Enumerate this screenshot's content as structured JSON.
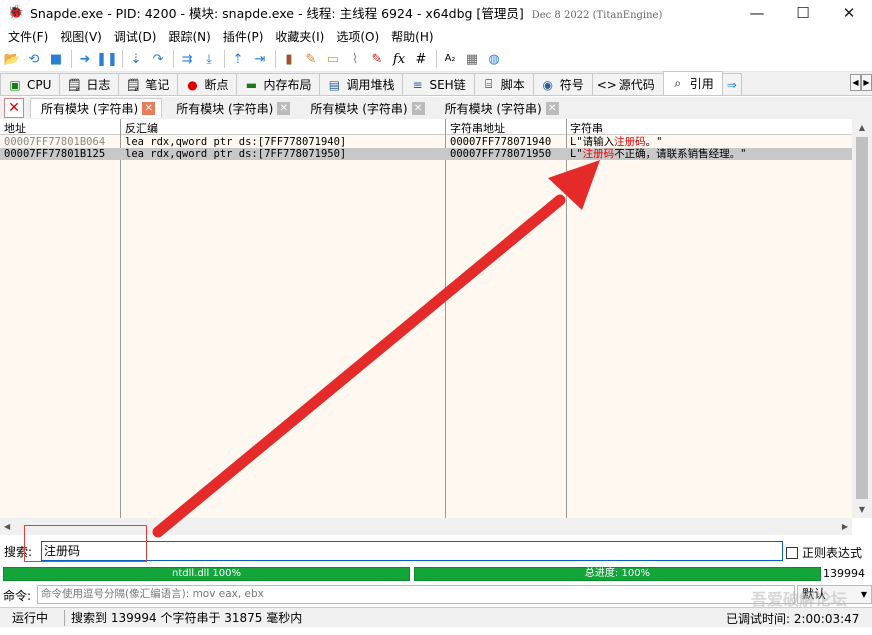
{
  "titlebar": {
    "title": "Snapde.exe - PID: 4200 - 模块: snapde.exe - 线程: 主线程 6924 - x64dbg [管理员]",
    "date": "Dec 8 2022 (TitanEngine)"
  },
  "menu": [
    "文件(F)",
    "视图(V)",
    "调试(D)",
    "跟踪(N)",
    "插件(P)",
    "收藏夹(I)",
    "选项(O)",
    "帮助(H)"
  ],
  "tabs1": [
    {
      "label": "CPU",
      "icon": "cpu-icon",
      "glyph": "▣"
    },
    {
      "label": "日志",
      "icon": "log-icon",
      "glyph": "📄"
    },
    {
      "label": "笔记",
      "icon": "notes-icon",
      "glyph": "📄"
    },
    {
      "label": "断点",
      "icon": "breakpoint-icon",
      "glyph": "●"
    },
    {
      "label": "内存布局",
      "icon": "memory-icon",
      "glyph": "▬"
    },
    {
      "label": "调用堆栈",
      "icon": "callstack-icon",
      "glyph": "▤"
    },
    {
      "label": "SEH链",
      "icon": "seh-icon",
      "glyph": "≡"
    },
    {
      "label": "脚本",
      "icon": "script-icon",
      "glyph": "📜"
    },
    {
      "label": "符号",
      "icon": "symbol-icon",
      "glyph": "◉"
    },
    {
      "label": "源代码",
      "icon": "source-icon",
      "glyph": "<>"
    },
    {
      "label": "引用",
      "icon": "references-icon",
      "glyph": "🔍"
    }
  ],
  "tabs2": [
    "所有模块 (字符串)",
    "所有模块 (字符串)",
    "所有模块 (字符串)",
    "所有模块 (字符串)"
  ],
  "grid": {
    "headers": [
      "地址",
      "反汇编",
      "字符串地址",
      "字符串"
    ],
    "rows": [
      {
        "addr": "00007FF77801B064",
        "disasm": "lea rdx,qword ptr ds:[7FF778071940]",
        "straddr": "00007FF778071940",
        "str_pre": "L\"请输入",
        "str_hl": "注册码",
        "str_post": "。\""
      },
      {
        "addr": "00007FF77801B125",
        "disasm": "lea rdx,qword ptr ds:[7FF778071950]",
        "straddr": "00007FF778071950",
        "str_pre": "L\"",
        "str_hl": "注册码",
        "str_post": "不正确，请联系销售经理。\""
      }
    ]
  },
  "search": {
    "label": "搜索:",
    "value": "注册码",
    "regex_label": "正则表达式"
  },
  "progress": {
    "module_label": "ntdll.dll 100%",
    "module_value": 100,
    "total_label": "总进度: 100%",
    "total_value": 100,
    "count": "139994"
  },
  "command": {
    "label": "命令:",
    "placeholder": "命令使用逗号分隔(像汇编语言): mov eax, ebx",
    "mode": "默认"
  },
  "status": {
    "state": "运行中",
    "message": "搜索到 139994 个字符串于 31875 毫秒内",
    "elapsed": "已调试时间: 2:00:03:47"
  },
  "watermark": "吾爱破解论坛",
  "colors": {
    "highlight": "#e00000",
    "progress": "#14a53a",
    "arrow": "#e52a2a",
    "selection": "#c8c8c8",
    "grid_bg": "#fff8f0"
  }
}
